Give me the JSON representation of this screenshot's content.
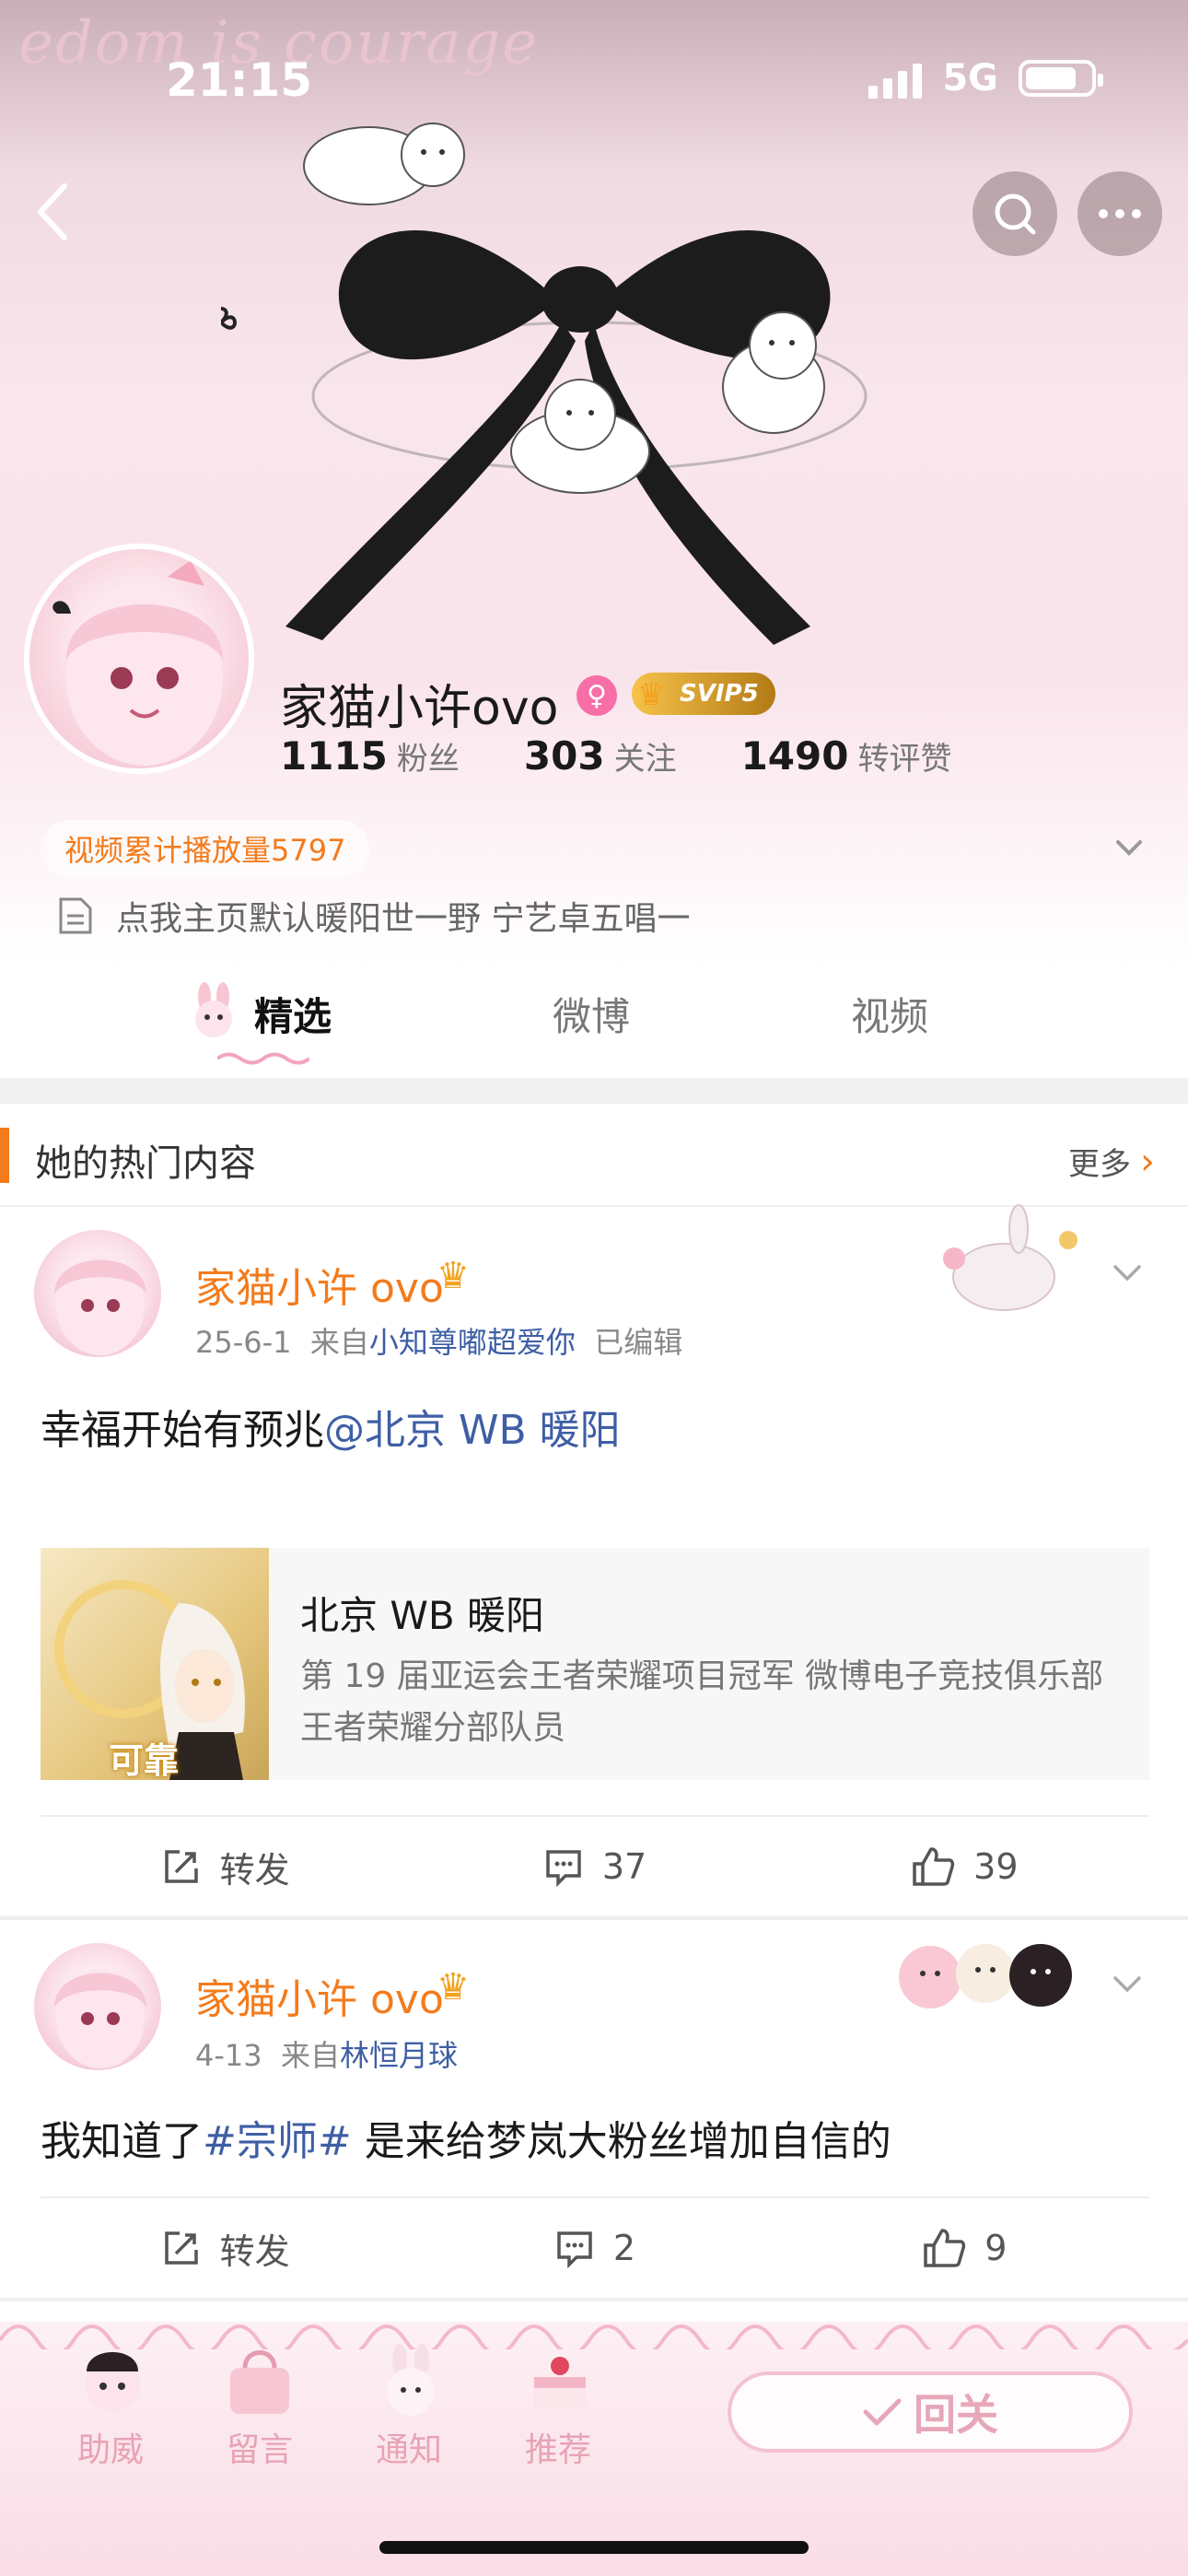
{
  "status_bar": {
    "time": "21:15",
    "network": "5G"
  },
  "header": {
    "cover_script": "edom is courage",
    "profile": {
      "name": "家猫小许ovo",
      "vip_badge": "SVIP5",
      "gender_icon": "female-icon"
    },
    "stats": [
      {
        "num": "1115",
        "label": "粉丝"
      },
      {
        "num": "303",
        "label": "关注"
      },
      {
        "num": "1490",
        "label": "转评赞"
      }
    ],
    "views_tag": "视频累计播放量5797",
    "bio": "点我主页默认暖阳世一野 宁艺卓五唱一"
  },
  "tabs": [
    {
      "label": "精选",
      "active": true
    },
    {
      "label": "微博",
      "active": false
    },
    {
      "label": "视频",
      "active": false
    }
  ],
  "hot_section": {
    "title": "她的热门内容",
    "more": "更多"
  },
  "posts": [
    {
      "author": "家猫小许 ovo",
      "date": "25-6-1",
      "from_prefix": "来自",
      "source": "小知尊嘟超爱你",
      "edited": "已编辑",
      "text_plain": "幸福开始有预兆",
      "text_link": "@北京 WB 暖阳",
      "card": {
        "title": "北京 WB 暖阳",
        "desc": "第 19 届亚运会王者荣耀项目冠军  微博电子竞技俱乐部王者荣耀分部队员",
        "thumb_tag": "可靠"
      },
      "actions": {
        "repost": "转发",
        "comments": "37",
        "likes": "39"
      }
    },
    {
      "author": "家猫小许 ovo",
      "date": "4-13",
      "from_prefix": "来自",
      "source": "林恒月球",
      "text_plain_1": "我知道了",
      "text_link": "#宗师#",
      "text_plain_2": " 是来给梦岚大粉丝增加自信的",
      "actions": {
        "repost": "转发",
        "comments": "2",
        "likes": "9"
      }
    }
  ],
  "bottom_bar": {
    "items": [
      "助威",
      "留言",
      "通知",
      "推荐"
    ],
    "follow_label": "回关"
  },
  "colors": {
    "accent_orange": "#f37b1c",
    "link_blue": "#3e5ea5",
    "pink": "#f3c2d0"
  }
}
